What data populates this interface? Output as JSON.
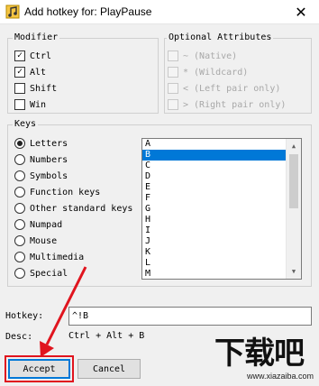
{
  "window": {
    "title": "Add hotkey for: PlayPause",
    "close_glyph": "✕"
  },
  "modifier": {
    "label": "Modifier",
    "items": [
      {
        "label": "Ctrl",
        "checked": true
      },
      {
        "label": "Alt",
        "checked": true
      },
      {
        "label": "Shift",
        "checked": false
      },
      {
        "label": "Win",
        "checked": false
      }
    ]
  },
  "optional": {
    "label": "Optional Attributes",
    "items": [
      {
        "label": "~ (Native)"
      },
      {
        "label": "* (Wildcard)"
      },
      {
        "label": "< (Left pair only)"
      },
      {
        "label": "> (Right pair only)"
      }
    ]
  },
  "keys": {
    "label": "Keys",
    "types": [
      {
        "label": "Letters",
        "selected": true
      },
      {
        "label": "Numbers",
        "selected": false
      },
      {
        "label": "Symbols",
        "selected": false
      },
      {
        "label": "Function keys",
        "selected": false
      },
      {
        "label": "Other standard keys",
        "selected": false
      },
      {
        "label": "Numpad",
        "selected": false
      },
      {
        "label": "Mouse",
        "selected": false
      },
      {
        "label": "Multimedia",
        "selected": false
      },
      {
        "label": "Special",
        "selected": false
      }
    ],
    "list": [
      "A",
      "B",
      "C",
      "D",
      "E",
      "F",
      "G",
      "H",
      "I",
      "J",
      "K",
      "L",
      "M"
    ],
    "selected_index": 1
  },
  "hotkey": {
    "label": "Hotkey:",
    "value": "^!B"
  },
  "desc": {
    "label": "Desc:",
    "value": "Ctrl + Alt + B"
  },
  "buttons": {
    "accept": "Accept",
    "cancel": "Cancel"
  },
  "annotation": {
    "color": "#e0141e"
  },
  "watermark": {
    "logo": "下载吧",
    "url": "www.xiazaiba.com"
  },
  "colors": {
    "selection": "#0078d7",
    "accent_border": "#0078d7"
  }
}
